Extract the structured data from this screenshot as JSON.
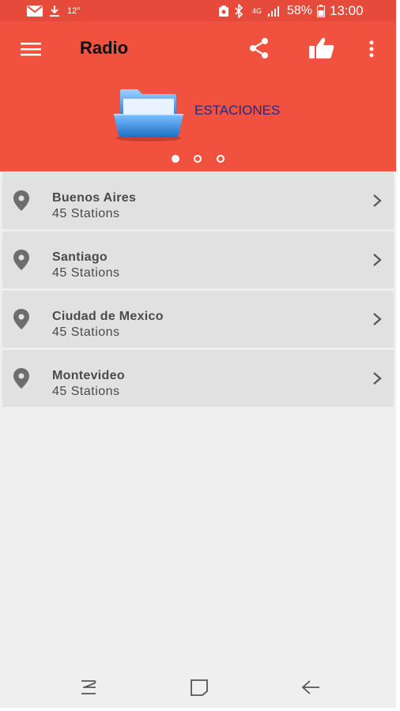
{
  "status_bar": {
    "temperature": "12°",
    "network": "4G",
    "battery": "58%",
    "time": "13:00"
  },
  "toolbar": {
    "title": "Radio",
    "icons": [
      "menu-icon",
      "share-icon",
      "thumbs-up-icon",
      "more-vert-icon"
    ]
  },
  "banner": {
    "label": "ESTACIONES",
    "pages": 3,
    "active_page": 1
  },
  "cities": [
    {
      "name": "Buenos Aires",
      "stations": "45 Stations"
    },
    {
      "name": "Santiago",
      "stations": "45 Stations"
    },
    {
      "name": "Ciudad de Mexico",
      "stations": "45 Stations"
    },
    {
      "name": "Montevideo",
      "stations": "45 Stations"
    }
  ],
  "colors": {
    "app_bar": "#f0523f",
    "status_bar": "#e54a3a",
    "banner_label": "#1f2a8c",
    "row_background": "#e1e1e1"
  }
}
